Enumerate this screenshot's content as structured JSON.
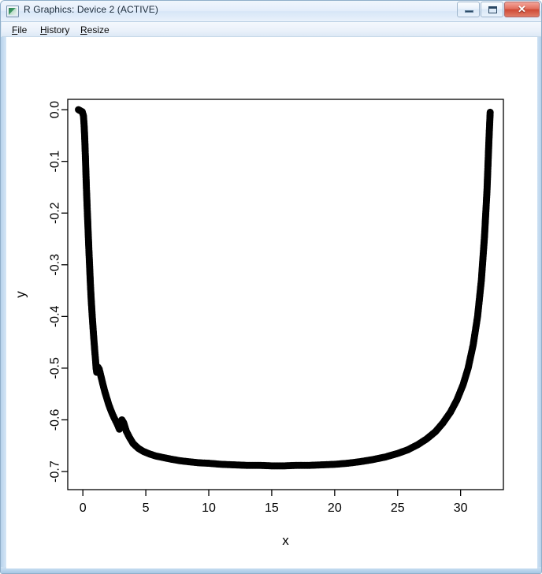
{
  "window": {
    "title": "R Graphics: Device 2 (ACTIVE)",
    "icon": "r-graphics-device-icon",
    "minimize_label": "",
    "maximize_label": "",
    "close_label": "✕"
  },
  "menu": {
    "items": [
      {
        "label": "File",
        "accel": "F"
      },
      {
        "label": "History",
        "accel": "H"
      },
      {
        "label": "Resize",
        "accel": "R"
      }
    ]
  },
  "colors": {
    "frame": "#b7d3ec",
    "titlebar": "#e4eefb",
    "close_button": "#cf4a35",
    "plot_ink": "#000000",
    "canvas": "#ffffff"
  },
  "chart_data": {
    "type": "scatter",
    "title": "",
    "xlabel": "x",
    "ylabel": "y",
    "xlim": [
      -1.2,
      33.4
    ],
    "ylim": [
      -0.735,
      0.02
    ],
    "xticks": [
      0,
      5,
      10,
      15,
      20,
      25,
      30
    ],
    "xticklabels": [
      "0",
      "5",
      "10",
      "15",
      "20",
      "25",
      "30"
    ],
    "yticks": [
      0.0,
      -0.1,
      -0.2,
      -0.3,
      -0.4,
      -0.5,
      -0.6,
      -0.7
    ],
    "yticklabels": [
      "0.0",
      "-0.1",
      "-0.2",
      "-0.3",
      "-0.4",
      "-0.5",
      "-0.6",
      "-0.7"
    ],
    "grid": false,
    "legend": null,
    "point_style": "filled-circle",
    "point_size": 9,
    "description": "Dense U-shaped (bathtub) curve of overlapping filled circles; steep near-vertical left branch at x about 0, two small kinks on the descent, broad flat minimum near y = -0.69 between x = 10 and x = 20, and a steep right branch rising back to y = 0 at x about 32.3",
    "x": [
      -0.35,
      -0.2,
      -0.05,
      0.05,
      0.1,
      0.14,
      0.17,
      0.2,
      0.22,
      0.24,
      0.26,
      0.28,
      0.3,
      0.32,
      0.34,
      0.36,
      0.38,
      0.4,
      0.42,
      0.44,
      0.46,
      0.48,
      0.5,
      0.52,
      0.54,
      0.56,
      0.58,
      0.6,
      0.63,
      0.66,
      0.7,
      0.74,
      0.78,
      0.82,
      0.86,
      0.9,
      0.95,
      1.0,
      1.05,
      1.1,
      1.15,
      1.2,
      1.3,
      1.4,
      1.5,
      1.6,
      1.75,
      1.9,
      2.05,
      2.2,
      2.35,
      2.5,
      2.65,
      2.8,
      2.9,
      3.0,
      3.1,
      3.25,
      3.45,
      3.7,
      4.0,
      4.4,
      4.8,
      5.3,
      5.8,
      6.4,
      7.0,
      7.7,
      8.4,
      9.2,
      10.0,
      11.0,
      12.0,
      13.0,
      14.0,
      15.0,
      16.0,
      17.0,
      18.0,
      19.0,
      20.0,
      21.0,
      22.0,
      23.0,
      24.0,
      25.0,
      25.8,
      26.6,
      27.3,
      28.0,
      28.6,
      29.2,
      29.7,
      30.2,
      30.6,
      31.0,
      31.35,
      31.65,
      31.9,
      32.1,
      32.25,
      32.35
    ],
    "y": [
      0.0,
      -0.002,
      -0.004,
      -0.012,
      -0.03,
      -0.05,
      -0.07,
      -0.09,
      -0.105,
      -0.12,
      -0.135,
      -0.15,
      -0.162,
      -0.175,
      -0.188,
      -0.2,
      -0.212,
      -0.224,
      -0.236,
      -0.248,
      -0.26,
      -0.272,
      -0.283,
      -0.294,
      -0.305,
      -0.316,
      -0.327,
      -0.338,
      -0.352,
      -0.366,
      -0.382,
      -0.398,
      -0.412,
      -0.426,
      -0.44,
      -0.452,
      -0.468,
      -0.482,
      -0.5,
      -0.508,
      -0.5,
      -0.498,
      -0.502,
      -0.512,
      -0.522,
      -0.532,
      -0.546,
      -0.558,
      -0.57,
      -0.58,
      -0.589,
      -0.597,
      -0.604,
      -0.612,
      -0.618,
      -0.604,
      -0.6,
      -0.606,
      -0.622,
      -0.634,
      -0.646,
      -0.655,
      -0.661,
      -0.666,
      -0.67,
      -0.673,
      -0.676,
      -0.679,
      -0.681,
      -0.683,
      -0.684,
      -0.686,
      -0.687,
      -0.688,
      -0.688,
      -0.689,
      -0.689,
      -0.688,
      -0.688,
      -0.687,
      -0.686,
      -0.684,
      -0.681,
      -0.677,
      -0.672,
      -0.665,
      -0.658,
      -0.648,
      -0.637,
      -0.623,
      -0.606,
      -0.585,
      -0.562,
      -0.532,
      -0.5,
      -0.455,
      -0.4,
      -0.33,
      -0.245,
      -0.155,
      -0.06,
      -0.005
    ]
  }
}
